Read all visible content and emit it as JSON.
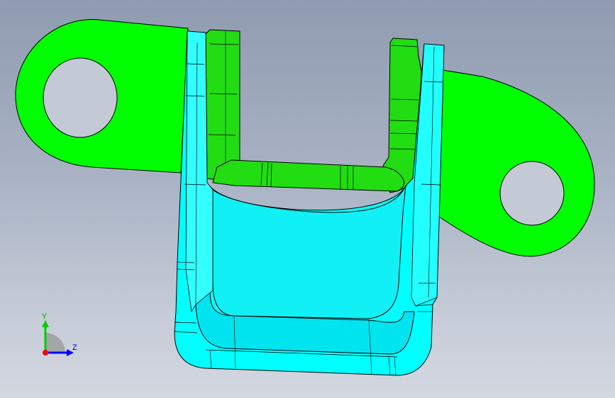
{
  "viewport": {
    "background_top": "#8f9bb0",
    "background_bottom": "#d4d8e1"
  },
  "model": {
    "bracket_color": "#00ff00",
    "bracket_shade": "#33cc11",
    "channel_color": "#00ffff",
    "channel_shade": "#22d6e6",
    "edge_color": "#000000"
  },
  "triad": {
    "y_label": "Y",
    "z_label": "Z",
    "y_color": "#00cc00",
    "z_color": "#0000ff",
    "x_color": "#ff0000"
  }
}
